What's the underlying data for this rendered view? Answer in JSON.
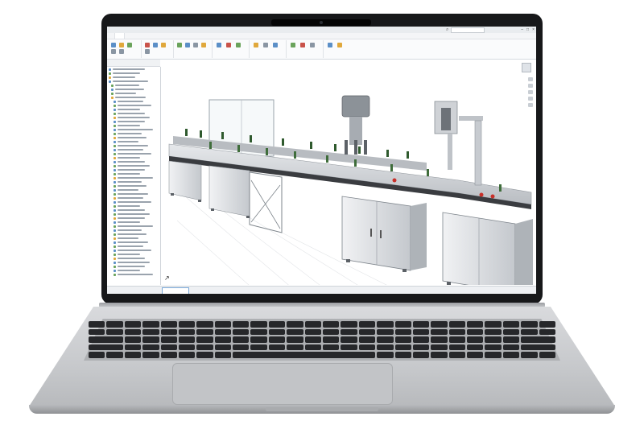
{
  "window": {
    "title": "",
    "controls": [
      "–",
      "□",
      "×"
    ]
  },
  "menubar": {
    "tabs": [
      {
        "label": ""
      },
      {
        "label": ""
      },
      {
        "label": ""
      },
      {
        "label": ""
      },
      {
        "label": ""
      },
      {
        "label": ""
      },
      {
        "label": ""
      },
      {
        "label": ""
      },
      {
        "label": ""
      },
      {
        "label": ""
      },
      {
        "label": ""
      },
      {
        "label": ""
      }
    ]
  },
  "feature_tree": {
    "header": ""
  },
  "statusbar": {
    "text": "",
    "document_tab": ""
  },
  "colors": {
    "accent": "#0a4a8a",
    "machine_body": "#cfd2d6",
    "bottle_green": "#2f5a2e",
    "conveyor_dark": "#3a3c40",
    "red_button": "#c8302a"
  },
  "icons": {
    "search": "search-icon",
    "view_cube": "view-cube-icon",
    "triad": "axis-triad-icon"
  }
}
